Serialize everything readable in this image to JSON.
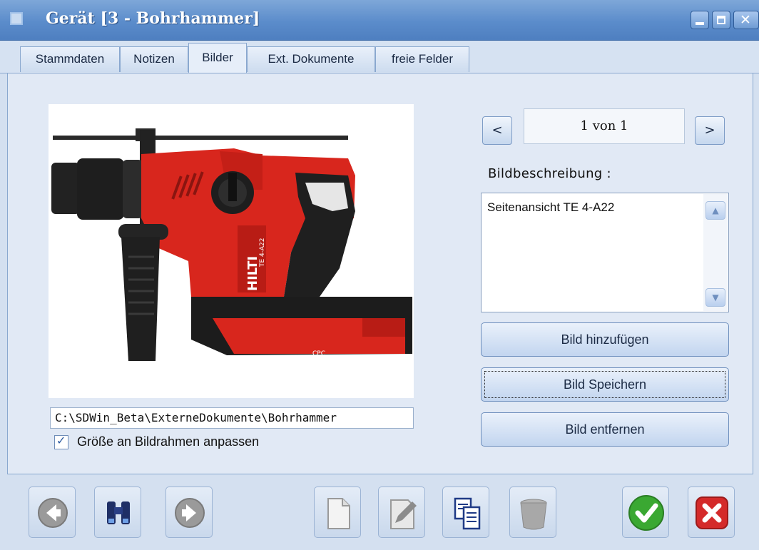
{
  "window": {
    "title": "Gerät [3 - Bohrhammer]"
  },
  "tabs": [
    {
      "label": "Stammdaten"
    },
    {
      "label": "Notizen"
    },
    {
      "label": "Bilder"
    },
    {
      "label": "Ext. Dokumente"
    },
    {
      "label": "freie Felder"
    }
  ],
  "image": {
    "path": "C:\\SDWin_Beta\\ExterneDokumente\\Bohrhammer",
    "fit_checkbox_label": "Größe an Bildrahmen anpassen",
    "fit_checked": true,
    "logo_text": "HILTI",
    "model_text": "TE 4-A22",
    "badge_text": "CPC"
  },
  "navigation": {
    "prev_label": "<",
    "next_label": ">",
    "counter": "1 von 1"
  },
  "description": {
    "label": "Bildbeschreibung :",
    "value": "Seitenansicht TE 4-A22"
  },
  "buttons": {
    "add": "Bild hinzufügen",
    "save": "Bild Speichern",
    "remove": "Bild entfernen"
  },
  "toolbar_icons": [
    "back-arrow-icon",
    "binoculars-icon",
    "forward-arrow-icon",
    "new-document-icon",
    "edit-icon",
    "copy-icon",
    "trash-icon",
    "confirm-icon",
    "cancel-icon"
  ],
  "colors": {
    "title_bar": "#5b8ccb",
    "confirm": "#3aa832",
    "cancel": "#d42a2a",
    "tool_red": "#d8261d"
  }
}
